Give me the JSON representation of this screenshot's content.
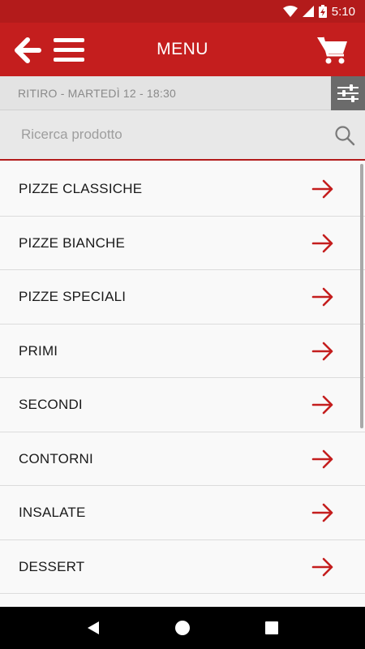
{
  "status_bar": {
    "time": "5:10",
    "icons": [
      "wifi-icon",
      "signal-icon",
      "battery-charging-icon"
    ]
  },
  "app_bar": {
    "title": "MENU",
    "icons": [
      "back-arrow-icon",
      "hamburger-menu-icon",
      "shopping-cart-icon"
    ],
    "background_color": "#c41e1e"
  },
  "pickup": {
    "text": "RITIRO - MARTEDÌ 12 - 18:30",
    "filter_icon": "sliders-icon"
  },
  "search": {
    "placeholder": "Ricerca prodotto",
    "value": "",
    "icon": "search-icon"
  },
  "categories": [
    {
      "label": "PIZZE CLASSICHE"
    },
    {
      "label": "PIZZE BIANCHE"
    },
    {
      "label": "PIZZE SPECIALI"
    },
    {
      "label": "PRIMI"
    },
    {
      "label": "SECONDI"
    },
    {
      "label": "CONTORNI"
    },
    {
      "label": "INSALATE"
    },
    {
      "label": "DESSERT"
    },
    {
      "label": ""
    }
  ],
  "arrow_icon": "arrow-right-icon",
  "arrow_color": "#c41e1e",
  "nav_bar": {
    "icons": [
      "nav-back-icon",
      "nav-home-icon",
      "nav-recents-icon"
    ]
  }
}
